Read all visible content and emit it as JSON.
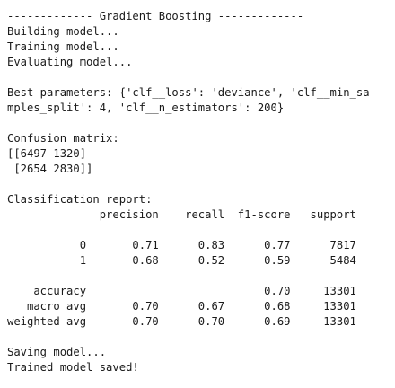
{
  "output": {
    "lines": [
      "------------- Gradient Boosting -------------",
      "Building model...",
      "Training model...",
      "Evaluating model...",
      "",
      "Best parameters: {'clf__loss': 'deviance', 'clf__min_sa",
      "mples_split': 4, 'clf__n_estimators': 200}",
      "",
      "Confusion matrix:",
      "[[6497 1320]",
      " [2654 2830]]",
      "",
      "Classification report:",
      "              precision    recall  f1-score   support",
      "",
      "           0       0.71      0.83      0.77      7817",
      "           1       0.68      0.52      0.59      5484",
      "",
      "    accuracy                           0.70     13301",
      "   macro avg       0.70      0.67      0.68     13301",
      "weighted avg       0.70      0.70      0.69     13301",
      "",
      "Saving model...",
      "Trained model saved!"
    ]
  }
}
